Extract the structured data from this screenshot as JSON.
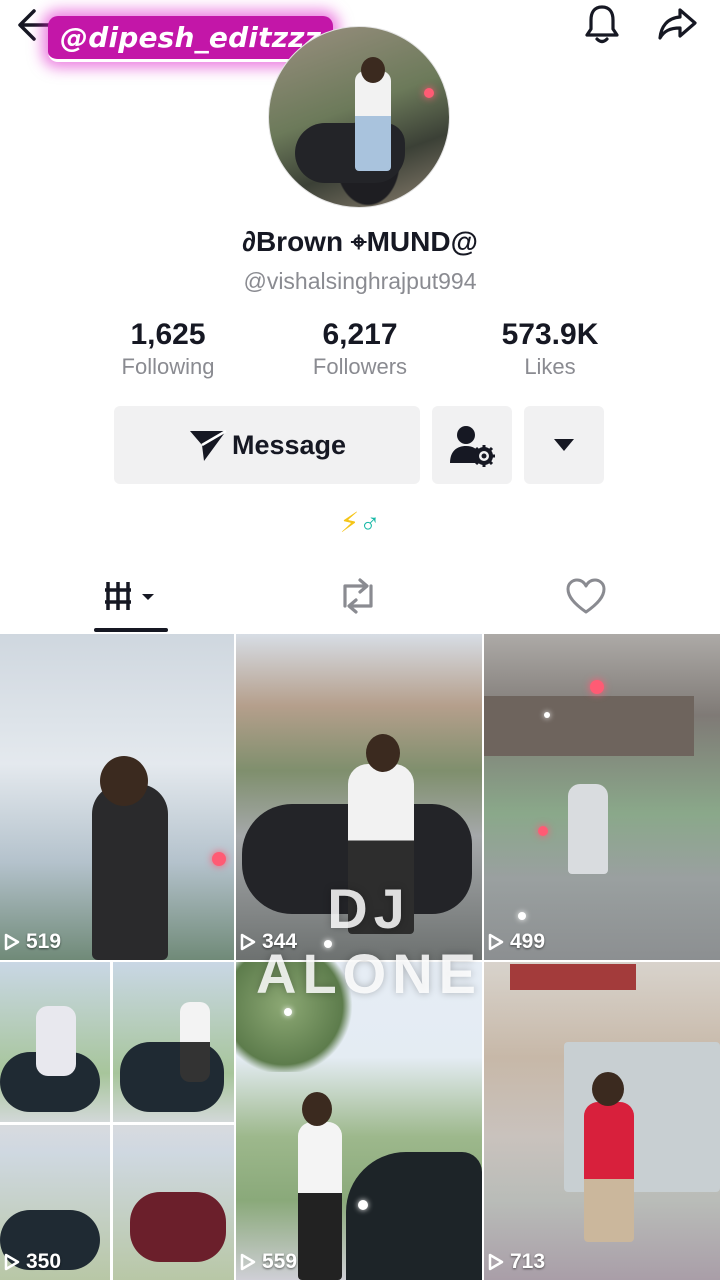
{
  "watermark": "@dipesh_editzzz",
  "profile": {
    "nickname": "∂Brown ⌖MUND@",
    "username": "@vishalsinghrajput994",
    "bio": {
      "bolt": "⚡",
      "male": "♂"
    }
  },
  "stats": [
    {
      "value": "1,625",
      "label": "Following"
    },
    {
      "value": "6,217",
      "label": "Followers"
    },
    {
      "value": "573.9K",
      "label": "Likes"
    }
  ],
  "actions": {
    "message_label": "Message"
  },
  "videos": [
    {
      "views": "519"
    },
    {
      "views": "344"
    },
    {
      "views": "499"
    },
    {
      "views": "350"
    },
    {
      "views": "559"
    },
    {
      "views": "713"
    }
  ],
  "overlay_text": "DJ ALONE",
  "colors": {
    "accent": "#c316a8",
    "muted": "#8a8b91",
    "button_bg": "#f1f1f2"
  },
  "icons": {
    "back": "arrow-left-icon",
    "bell": "bell-icon",
    "share": "share-icon",
    "message": "send-icon",
    "friends": "user-settings-icon",
    "more": "caret-down-icon",
    "videos_tab": "grid-icon",
    "reposts_tab": "repost-icon",
    "liked_tab": "heart-icon",
    "play": "play-icon"
  }
}
